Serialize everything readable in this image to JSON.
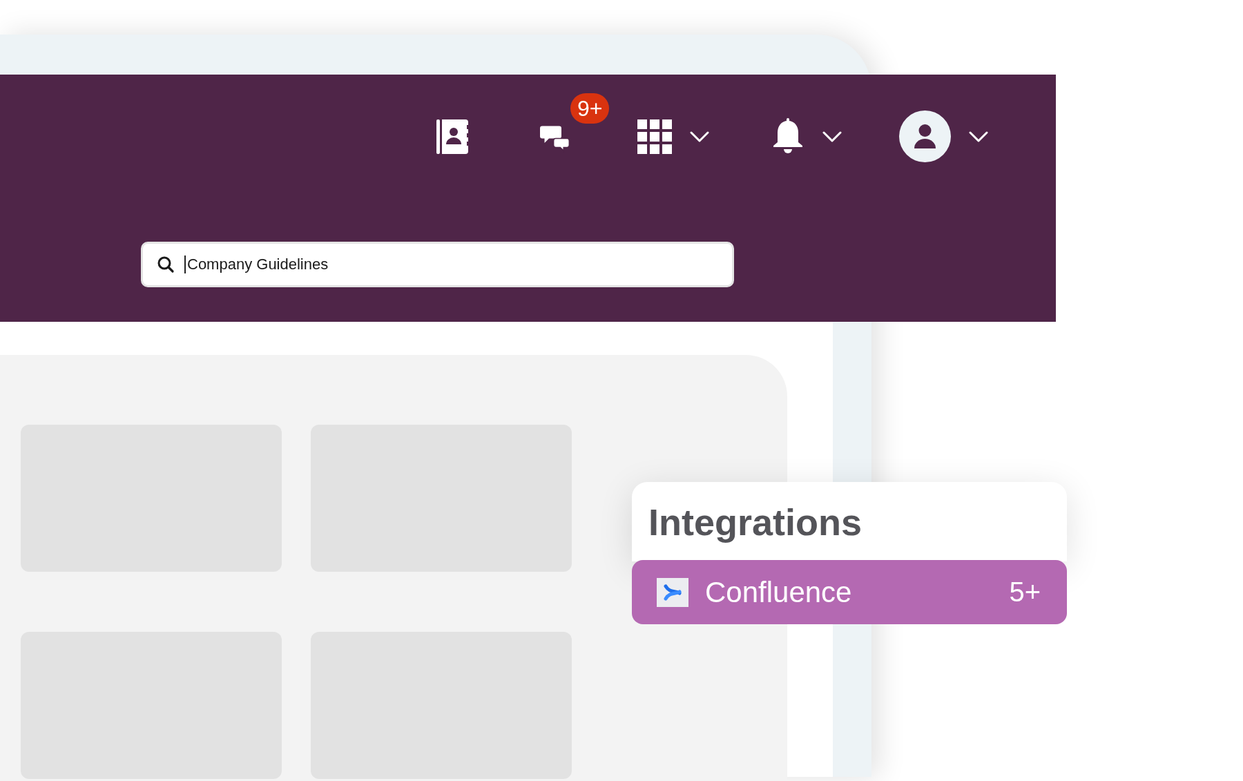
{
  "header": {
    "icons": [
      {
        "kind": "contacts",
        "dropdown": false
      },
      {
        "kind": "chat",
        "dropdown": false,
        "badge": "9+"
      },
      {
        "kind": "apps",
        "dropdown": true
      },
      {
        "kind": "notifications",
        "dropdown": true
      },
      {
        "kind": "profile",
        "dropdown": true
      }
    ],
    "search": {
      "value": "Company Guidelines"
    }
  },
  "integrations": {
    "title": "Integrations",
    "items": [
      {
        "name": "Confluence",
        "count": "5+",
        "selected": true
      }
    ]
  }
}
